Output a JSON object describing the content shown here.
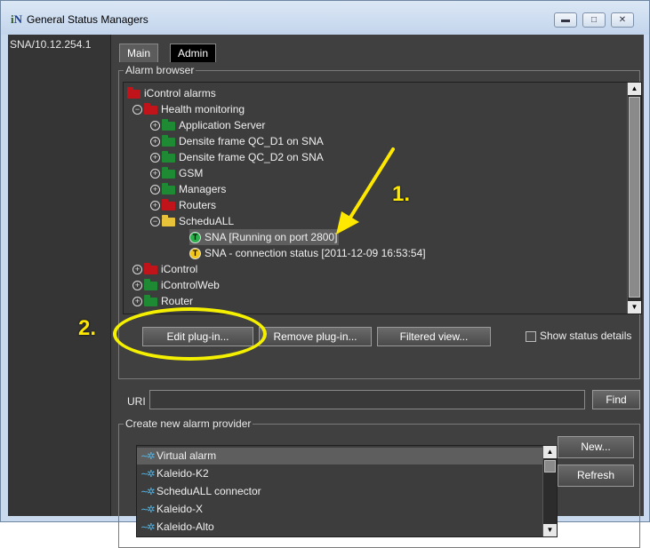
{
  "window": {
    "title": "General Status Managers",
    "app_icon": "iN",
    "controls": [
      "minimize",
      "maximize",
      "close"
    ]
  },
  "sidebar": {
    "items": [
      "SNA/10.12.254.1"
    ]
  },
  "tabs": [
    {
      "label": "Main",
      "active": true
    },
    {
      "label": "Admin",
      "active": false
    }
  ],
  "alarm_browser": {
    "legend": "Alarm browser",
    "nodes": [
      {
        "label": "iControl alarms",
        "icon": "folder-red",
        "depth": 0
      },
      {
        "label": "Health monitoring",
        "icon": "folder-red",
        "depth": 1,
        "expanded": true
      },
      {
        "label": "Application Server",
        "icon": "folder-green",
        "depth": 2
      },
      {
        "label": "Densite frame QC_D1 on SNA",
        "icon": "folder-green",
        "depth": 2
      },
      {
        "label": "Densite frame QC_D2 on SNA",
        "icon": "folder-green",
        "depth": 2
      },
      {
        "label": "GSM",
        "icon": "folder-green",
        "depth": 2
      },
      {
        "label": "Managers",
        "icon": "folder-green",
        "depth": 2
      },
      {
        "label": "Routers",
        "icon": "folder-red",
        "depth": 2
      },
      {
        "label": "ScheduALL",
        "icon": "folder-yellow",
        "depth": 2,
        "expanded": true
      },
      {
        "label": "SNA [Running on port 2800]",
        "icon": "badge-green",
        "badge": "T",
        "depth": 3,
        "selected": true
      },
      {
        "label": "SNA - connection status [2011-12-09 16:53:54]",
        "icon": "badge-yellow",
        "badge": "T",
        "depth": 3
      },
      {
        "label": "iControl",
        "icon": "folder-red",
        "depth": 1
      },
      {
        "label": "iControlWeb",
        "icon": "folder-green",
        "depth": 1
      },
      {
        "label": "Router",
        "icon": "folder-green",
        "depth": 1
      }
    ]
  },
  "buttons": {
    "edit_plugin": "Edit plug-in...",
    "remove_plugin": "Remove plug-in...",
    "filtered_view": "Filtered view...",
    "find": "Find",
    "new": "New...",
    "refresh": "Refresh"
  },
  "show_status_details": {
    "label": "Show status details",
    "checked": false
  },
  "uri": {
    "label": "URI",
    "value": ""
  },
  "alarm_provider": {
    "legend": "Create new alarm provider",
    "items": [
      "Virtual alarm",
      "Kaleido-K2",
      "ScheduALL connector",
      "Kaleido-X",
      "Kaleido-Alto"
    ],
    "selected_index": 0
  },
  "annotations": {
    "callout_1": "1.",
    "callout_2": "2."
  },
  "colors": {
    "panel": "#404040",
    "highlight_yellow": "#ffe800",
    "title_bar": "#c9daee"
  }
}
